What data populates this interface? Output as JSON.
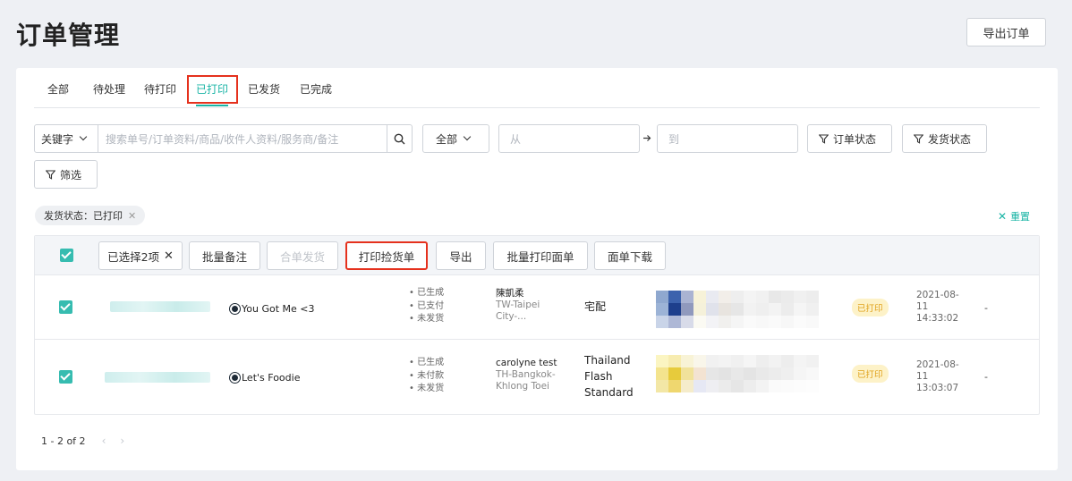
{
  "page": {
    "title": "订单管理",
    "export_label": "导出订单"
  },
  "tabs": [
    {
      "label": "全部"
    },
    {
      "label": "待处理"
    },
    {
      "label": "待打印"
    },
    {
      "label": "已打印"
    },
    {
      "label": "已发货"
    },
    {
      "label": "已完成"
    }
  ],
  "active_tab": "已打印",
  "filters": {
    "keyword_select": "关键字",
    "search_placeholder": "搜索单号/订单资料/商品/收件人资料/服务商/备注",
    "scope_select": "全部",
    "date_from_placeholder": "从",
    "date_to_placeholder": "到",
    "order_status_label": "订单状态",
    "ship_status_label": "发货状态",
    "filter_label": "筛选"
  },
  "active_filter_chip": "发货状态：已打印",
  "reset_label": "重置",
  "bulk": {
    "selected_label": "已选择2项",
    "batch_note": "批量备注",
    "merge_ship": "合单发货",
    "print_picking": "打印捡货单",
    "export": "导出",
    "batch_print_label": "批量打印面单",
    "download_label": "面单下载"
  },
  "orders": [
    {
      "shop": "You Got Me <3",
      "statuses": [
        "已生成",
        "已支付",
        "未发货"
      ],
      "buyer_name": "陳凱柔",
      "buyer_addr_1": "TW-Taipei",
      "buyer_addr_2": "City-...",
      "carrier": "宅配",
      "badge": "已打印",
      "time_1": "2021-08-",
      "time_2": "11",
      "time_3": "14:33:02",
      "extra": "-"
    },
    {
      "shop": "Let's Foodie",
      "statuses": [
        "已生成",
        "未付款",
        "未发货"
      ],
      "buyer_name": "carolyne test",
      "buyer_addr_1": "TH-Bangkok-",
      "buyer_addr_2": "Khlong Toei",
      "carrier_1": "Thailand",
      "carrier_2": "Flash",
      "carrier_3": "Standard",
      "badge": "已打印",
      "time_1": "2021-08-",
      "time_2": "11",
      "time_3": "13:03:07",
      "extra": "-"
    }
  ],
  "pagination": {
    "range": "1 - 2 of 2"
  },
  "colors": {
    "accent": "#19b4a5",
    "highlight": "#e5311d",
    "badge_text": "#e0a11a",
    "badge_bg": "#fdf2c8"
  }
}
